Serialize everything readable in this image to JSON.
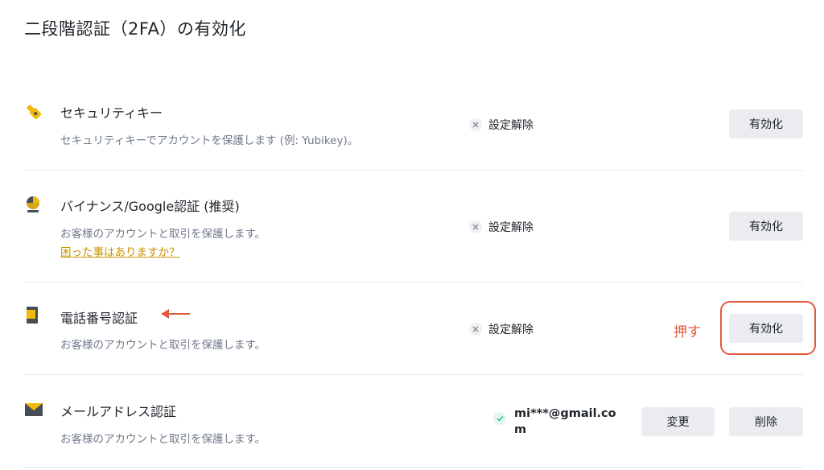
{
  "page": {
    "title": "二段階認証（2FA）の有効化"
  },
  "rows": [
    {
      "title": "セキュリティキー",
      "desc": "セキュリティキーでアカウントを保護します (例: Yubikey)。",
      "status": "設定解除",
      "button": "有効化",
      "icon": "usb-key-icon"
    },
    {
      "title": "バイナンス/Google認証 (推奨)",
      "desc": "お客様のアカウントと取引を保護します。",
      "link": "困った事はありますか？",
      "status": "設定解除",
      "button": "有効化",
      "icon": "authenticator-icon"
    },
    {
      "title": "電話番号認証",
      "desc": "お客様のアカウントと取引を保護します。",
      "status": "設定解除",
      "button": "有効化",
      "icon": "phone-icon",
      "annotation": "押す"
    },
    {
      "title": "メールアドレス認証",
      "desc": "お客様のアカウントと取引を保護します。",
      "status_line1": "mi***@gmail.co",
      "status_line2": "m",
      "button_change": "変更",
      "button_delete": "削除",
      "icon": "mail-icon"
    }
  ],
  "colors": {
    "accent": "#f0b90b",
    "link": "#c99400",
    "annotation": "#e0593a",
    "button_bg": "#eaecef"
  }
}
